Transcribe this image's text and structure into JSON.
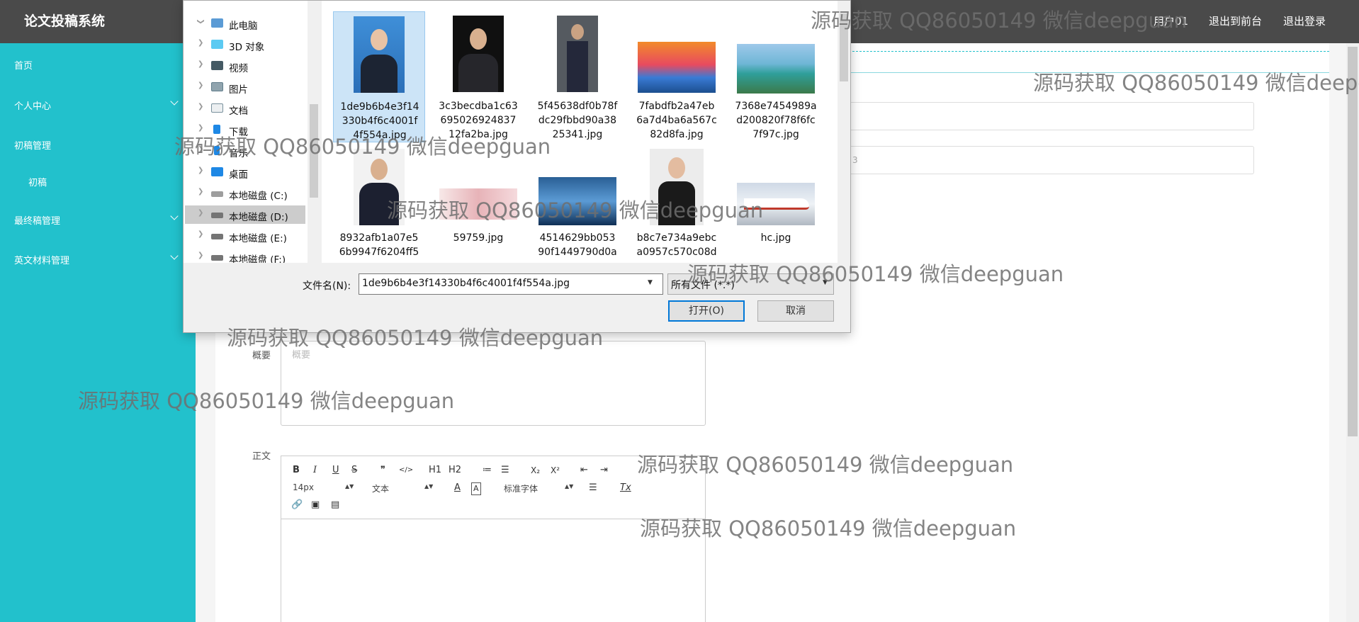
{
  "header": {
    "app_title": "论文投稿系统",
    "user_label": "用户01",
    "back_to_front": "退出到前台",
    "logout": "退出登录"
  },
  "sidebar": {
    "items": [
      {
        "label": "首页"
      },
      {
        "label": "个人中心"
      },
      {
        "label": "初稿管理"
      },
      {
        "label": "初稿"
      },
      {
        "label": "最终稿管理"
      },
      {
        "label": "英文材料管理"
      }
    ]
  },
  "form": {
    "input_2_value_fragment": "3",
    "summary_label": "概要",
    "summary_placeholder": "概要",
    "body_label": "正文"
  },
  "editor_toolbar": {
    "bold": "B",
    "italic": "I",
    "underline": "U",
    "strike": "S",
    "quote": "❞",
    "code": "</>",
    "h1": "H1",
    "h2": "H2",
    "ordered_list": "≔",
    "bullet_list": "☰",
    "subscript": "X₂",
    "superscript": "X²",
    "outdent": "⇤",
    "indent": "⇥",
    "font_size": "14px",
    "format": "文本",
    "font_color": "A",
    "background_color": "A",
    "font_family": "标准字体",
    "align": "☰",
    "clear_format": "Tx",
    "link": "🔗",
    "image": "▣",
    "video": "▤"
  },
  "file_dialog": {
    "tree": [
      {
        "label": "此电脑",
        "icon": "computer-icon"
      },
      {
        "label": "3D 对象",
        "icon": "3d-objects-icon"
      },
      {
        "label": "视频",
        "icon": "video-folder-icon"
      },
      {
        "label": "图片",
        "icon": "pictures-folder-icon"
      },
      {
        "label": "文档",
        "icon": "documents-folder-icon"
      },
      {
        "label": "下载",
        "icon": "download-folder-icon"
      },
      {
        "label": "音乐",
        "icon": "music-folder-icon"
      },
      {
        "label": "桌面",
        "icon": "desktop-folder-icon"
      },
      {
        "label": "本地磁盘 (C:)",
        "icon": "drive-icon"
      },
      {
        "label": "本地磁盘 (D:)",
        "icon": "drive-icon"
      },
      {
        "label": "本地磁盘 (E:)",
        "icon": "drive-icon"
      },
      {
        "label": "本地磁盘 (F:)",
        "icon": "drive-icon"
      }
    ],
    "files": [
      {
        "name": "1de9b6b4e3f14330b4f6c4001f4f554a.jpg",
        "lines": [
          "1de9b6b4e3f14",
          "330b4f6c4001f",
          "4f554a.jpg"
        ],
        "thumb": "portrait-blue"
      },
      {
        "name": "3c3becdba1c63695026924837 12fa2ba.jpg",
        "lines": [
          "3c3becdba1c63",
          "695026924837",
          "12fa2ba.jpg"
        ],
        "thumb": "portrait-dark"
      },
      {
        "name": "5f45638df0b78fdc29fbbd90a3825341.jpg",
        "lines": [
          "5f45638df0b78f",
          "dc29fbbd90a38",
          "25341.jpg"
        ],
        "thumb": "portrait-sitting"
      },
      {
        "name": "7fabdfb2a47eb6a7d4ba6a567c82d8fa.jpg",
        "lines": [
          "7fabdfb2a47eb",
          "6a7d4ba6a567c",
          "82d8fa.jpg"
        ],
        "thumb": "sunset"
      },
      {
        "name": "7368e7454989ad200820f78f6fc7f97c.jpg",
        "lines": [
          "7368e7454989a",
          "d200820f78f6fc",
          "7f97c.jpg"
        ],
        "thumb": "beach"
      },
      {
        "name": "8932afb1a07e56b9947f6204ff5",
        "lines": [
          "8932afb1a07e5",
          "6b9947f6204ff5"
        ],
        "thumb": "portrait-suit"
      },
      {
        "name": "59759.jpg",
        "lines": [
          "59759.jpg"
        ],
        "thumb": "flowers"
      },
      {
        "name": "4514629bb05390f1449790d0a",
        "lines": [
          "4514629bb053",
          "90f1449790d0a"
        ],
        "thumb": "sky"
      },
      {
        "name": "b8c7e734a9ebca0957c570c08d",
        "lines": [
          "b8c7e734a9ebc",
          "a0957c570c08d"
        ],
        "thumb": "portrait-woman"
      },
      {
        "name": "hc.jpg",
        "lines": [
          "hc.jpg"
        ],
        "thumb": "train"
      }
    ],
    "filename_label": "文件名(N):",
    "filename_value": "1de9b6b4e3f14330b4f6c4001f4f554a.jpg",
    "filetype_value": "所有文件 (*.*)",
    "open_button": "打开(O)",
    "cancel_button": "取消"
  },
  "watermark_text": "源码获取 QQ86050149 微信deepguan"
}
